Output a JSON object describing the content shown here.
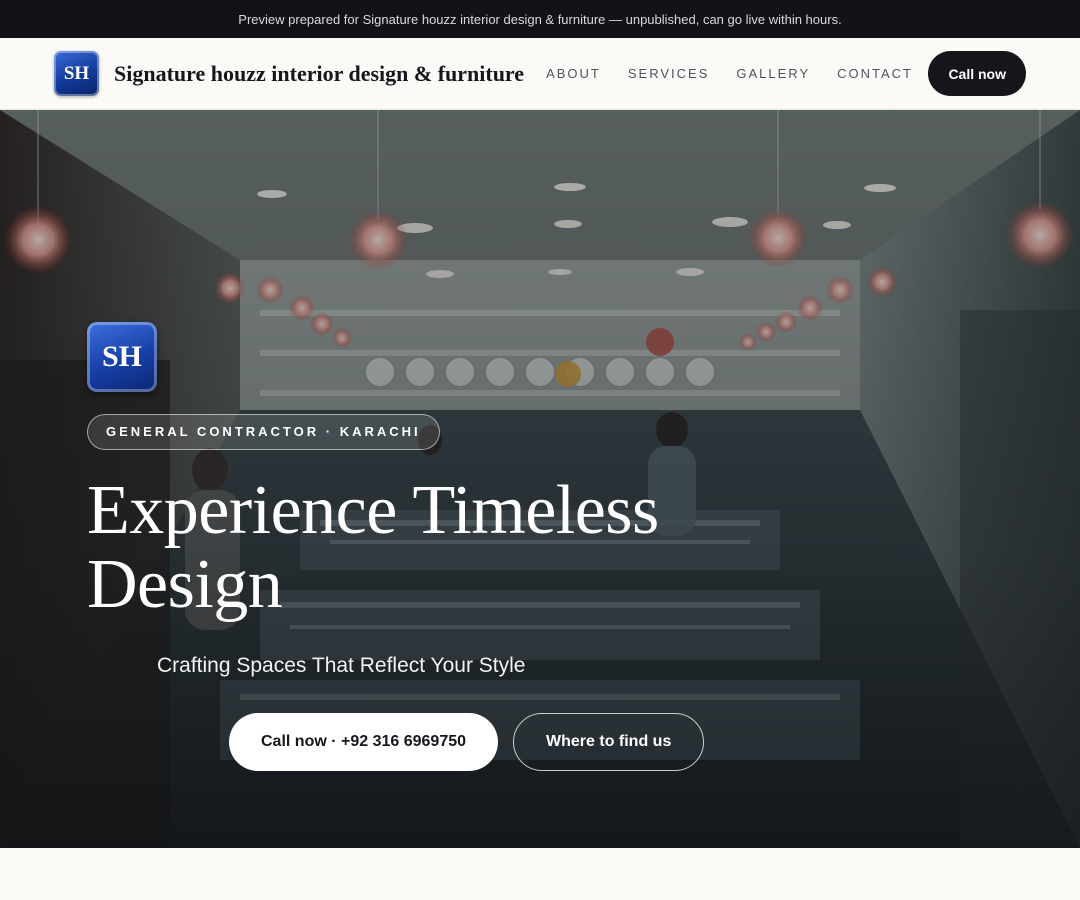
{
  "banner": {
    "text": "Preview prepared for Signature houzz interior design & furniture — unpublished, can go live within hours."
  },
  "brand": {
    "monogram": "SH",
    "name": "Signature houzz interior design & furniture"
  },
  "nav": {
    "links": [
      "ABOUT",
      "SERVICES",
      "GALLERY",
      "CONTACT"
    ],
    "cta": "Call now"
  },
  "hero": {
    "monogram": "SH",
    "tag": "GENERAL CONTRACTOR · KARACHI",
    "headline": "Experience Timeless Design",
    "subline": "Crafting Spaces That Reflect Your Style",
    "primary_cta": "Call now · +92 316 6969750",
    "secondary_cta": "Where to find us"
  },
  "colors": {
    "dark": "#14161b",
    "accent_blue": "#163fa6",
    "background": "#faf9f6"
  },
  "icons": {
    "logo": "monogram-logo-icon"
  }
}
